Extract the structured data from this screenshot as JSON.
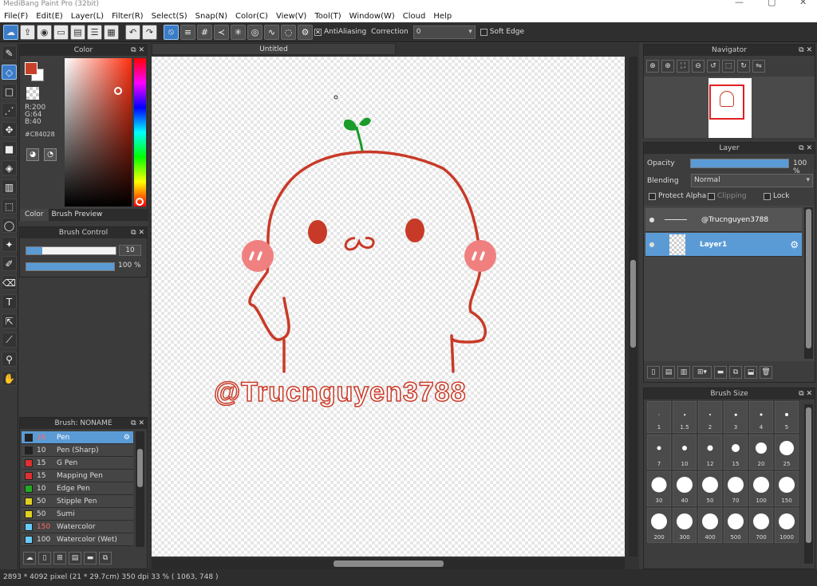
{
  "app": {
    "title": "MediBang Paint Pro (32bit)",
    "window_controls": [
      "—",
      "▢",
      "✕"
    ]
  },
  "menu": [
    "File(F)",
    "Edit(E)",
    "Layer(L)",
    "Filter(R)",
    "Select(S)",
    "Snap(N)",
    "Color(C)",
    "View(V)",
    "Tool(T)",
    "Window(W)",
    "Cloud",
    "Help"
  ],
  "toolbar": {
    "antialiasing_label": "AntiAliasing",
    "correction_label": "Correction",
    "correction_value": "0",
    "soft_edge_label": "Soft Edge"
  },
  "color_panel": {
    "title": "Color",
    "rgb": {
      "r": "R:200",
      "g": "G:64",
      "b": "B:40"
    },
    "hex": "#C84028",
    "tabs": [
      "Color",
      "Brush Preview"
    ],
    "foreground": "#c84028"
  },
  "brush_control": {
    "title": "Brush Control",
    "size_value": "10",
    "opacity_value": "100 %"
  },
  "brush_list": {
    "title": "Brush: NONAME",
    "items": [
      {
        "size": "16",
        "name": "Pen",
        "color": "#222222",
        "selected": true,
        "size_color": "#ff6b6b"
      },
      {
        "size": "10",
        "name": "Pen (Sharp)",
        "color": "#222222",
        "selected": false,
        "size_color": "#dddddd"
      },
      {
        "size": "15",
        "name": "G Pen",
        "color": "#e03030",
        "selected": false,
        "size_color": "#dddddd"
      },
      {
        "size": "15",
        "name": "Mapping Pen",
        "color": "#e03030",
        "selected": false,
        "size_color": "#dddddd"
      },
      {
        "size": "10",
        "name": "Edge Pen",
        "color": "#22aa22",
        "selected": false,
        "size_color": "#dddddd"
      },
      {
        "size": "50",
        "name": "Stipple Pen",
        "color": "#e0d020",
        "selected": false,
        "size_color": "#dddddd"
      },
      {
        "size": "50",
        "name": "Sumi",
        "color": "#e0d020",
        "selected": false,
        "size_color": "#dddddd"
      },
      {
        "size": "150",
        "name": "Watercolor",
        "color": "#66ccff",
        "selected": false,
        "size_color": "#ff6b6b"
      },
      {
        "size": "100",
        "name": "Watercolor (Wet)",
        "color": "#66ccff",
        "selected": false,
        "size_color": "#dddddd"
      }
    ]
  },
  "document": {
    "tab": "Untitled",
    "watermark": "@Trucnguyen3788"
  },
  "navigator": {
    "title": "Navigator"
  },
  "layer_panel": {
    "title": "Layer",
    "opacity_label": "Opacity",
    "opacity_value": "100 %",
    "blending_label": "Blending",
    "blending_value": "Normal",
    "protect_alpha": "Protect Alpha",
    "clipping": "Clipping",
    "lock": "Lock",
    "layers": [
      {
        "name": "@Trucnguyen3788",
        "selected": false
      },
      {
        "name": "Layer1",
        "selected": true
      }
    ]
  },
  "brush_size": {
    "title": "Brush Size",
    "sizes": [
      "1",
      "1.5",
      "2",
      "3",
      "4",
      "5",
      "7",
      "10",
      "12",
      "15",
      "20",
      "25",
      "30",
      "40",
      "50",
      "70",
      "100",
      "150",
      "200",
      "300",
      "400",
      "500",
      "700",
      "1000"
    ]
  },
  "status": "2893 * 4092 pixel   (21 * 29.7cm)   350 dpi   33 %   ( 1063, 748 )"
}
